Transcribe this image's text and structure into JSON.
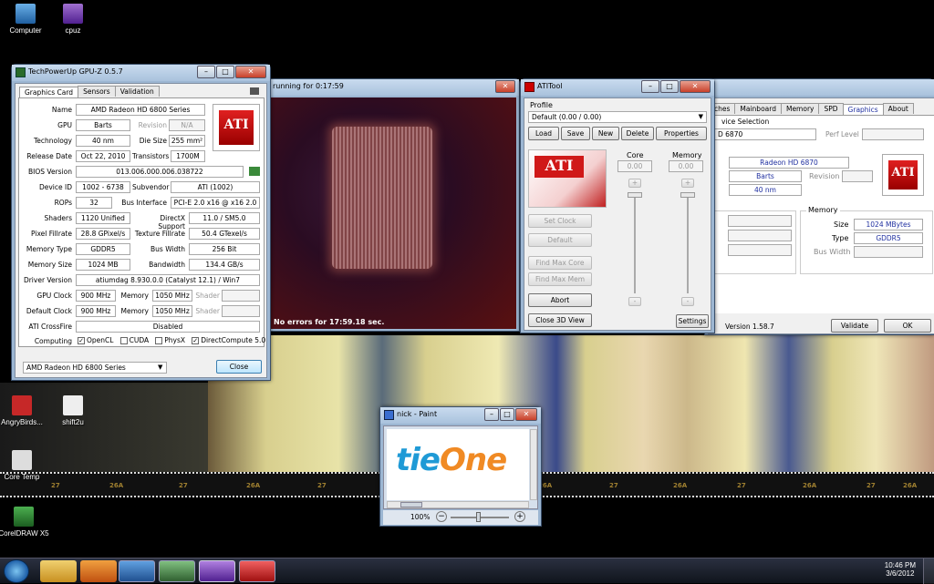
{
  "desktop": {
    "icons": [
      {
        "label": "Computer"
      },
      {
        "label": "cpuz"
      },
      {
        "label": "AngryBirds..."
      },
      {
        "label": "shift2u"
      },
      {
        "label": "Core Temp"
      },
      {
        "label": "CorelDRAW X5"
      }
    ],
    "film_numbers": [
      "27",
      "26A",
      "27",
      "26A",
      "27",
      "26A",
      "27",
      "26A",
      "27",
      "26A",
      "27",
      "26A"
    ]
  },
  "gpuz": {
    "title": "TechPowerUp GPU-Z 0.5.7",
    "tabs": [
      "Graphics Card",
      "Sensors",
      "Validation"
    ],
    "rows": {
      "name_label": "Name",
      "name": "AMD Radeon HD 6800 Series",
      "gpu_label": "GPU",
      "gpu": "Barts",
      "revision_label": "Revision",
      "revision": "N/A",
      "tech_label": "Technology",
      "tech": "40 nm",
      "die_label": "Die Size",
      "die": "255 mm²",
      "release_label": "Release Date",
      "release": "Oct 22, 2010",
      "trans_label": "Transistors",
      "trans": "1700M",
      "bios_label": "BIOS Version",
      "bios": "013.006.000.006.038722",
      "devid_label": "Device ID",
      "devid": "1002 - 6738",
      "subv_label": "Subvendor",
      "subv": "ATI (1002)",
      "rops_label": "ROPs",
      "rops": "32",
      "bus_label": "Bus Interface",
      "bus": "PCI-E 2.0 x16 @ x16 2.0",
      "shaders_label": "Shaders",
      "shaders": "1120 Unified",
      "dx_label": "DirectX Support",
      "dx": "11.0 / SM5.0",
      "pix_label": "Pixel Fillrate",
      "pix": "28.8 GPixel/s",
      "tex_label": "Texture Fillrate",
      "tex": "50.4 GTexel/s",
      "memtype_label": "Memory Type",
      "memtype": "GDDR5",
      "busw_label": "Bus Width",
      "busw": "256 Bit",
      "memsize_label": "Memory Size",
      "memsize": "1024 MB",
      "bw_label": "Bandwidth",
      "bw": "134.4 GB/s",
      "driver_label": "Driver Version",
      "driver": "atiumdag 8.930.0.0 (Catalyst 12.1) / Win7",
      "gpuclk_label": "GPU Clock",
      "gpuclk": "900 MHz",
      "mem_label": "Memory",
      "memclk": "1050 MHz",
      "shader_label": "Shader",
      "defclk_label": "Default Clock",
      "defclk": "900 MHz",
      "defmem": "1050 MHz",
      "cf_label": "ATI CrossFire",
      "cf": "Disabled",
      "comp_label": "Computing",
      "opencl": "OpenCL",
      "cuda": "CUDA",
      "physx": "PhysX",
      "dc": "DirectCompute 5.0"
    },
    "select": "AMD Radeon HD 6800 Series",
    "close": "Close"
  },
  "render": {
    "title": "running for 0:17:59",
    "status": "No errors for 17:59.18 sec."
  },
  "atitool": {
    "title": "ATITool",
    "profile_label": "Profile",
    "profile_value": "Default (0.00 / 0.00)",
    "buttons": [
      "Load",
      "Save",
      "New",
      "Delete",
      "Properties"
    ],
    "core_label": "Core",
    "core_value": "0.00",
    "memory_label": "Memory",
    "memory_value": "0.00",
    "side_buttons": [
      "Set Clock",
      "Default",
      "Find Max Core",
      "Find Max Mem",
      "Abort",
      "Close 3D View"
    ],
    "settings": "Settings"
  },
  "cpuz": {
    "tabs": [
      "ches",
      "Mainboard",
      "Memory",
      "SPD",
      "Graphics",
      "About"
    ],
    "device_selection": "vice Selection",
    "device": "D 6870",
    "perf_level": "Perf Level",
    "gpu_name": "Radeon HD 6870",
    "code": "Barts",
    "revision_label": "Revision",
    "tech": "40 nm",
    "memory_group": "Memory",
    "size_label": "Size",
    "size": "1024 MBytes",
    "type_label": "Type",
    "type": "GDDR5",
    "buswidth_label": "Bus Width",
    "version": "Version 1.58.7",
    "validate": "Validate",
    "ok": "OK"
  },
  "paint": {
    "title": "nick - Paint",
    "logo_part1": "tie",
    "logo_part2": "One",
    "zoom": "100%"
  },
  "taskbar": {
    "time": "10:46 PM",
    "date": "3/6/2012"
  }
}
